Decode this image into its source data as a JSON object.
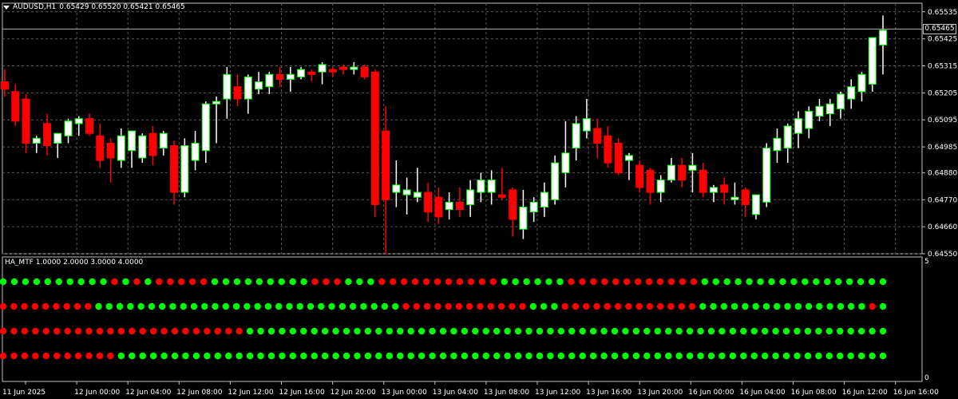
{
  "header": {
    "symbol": "AUDUSD,H1",
    "ohlc": "0.65429 0.65520 0.65421 0.65465"
  },
  "indicator": {
    "label": "HA_MTF 1.0000 2.0000 3.0000 4.0000",
    "scale_top": "5",
    "scale_bottom": "0"
  },
  "current_price": "0.65465",
  "colors": {
    "bull": "#00ff00",
    "bear": "#ff0000",
    "bull_body": "#ffffff",
    "bear_body": "#ff0000",
    "grid": "#5a5a5a",
    "background": "#000000"
  },
  "chart_data": {
    "type": "candlestick",
    "ylim": [
      0.6455,
      0.6557
    ],
    "price_ticks": [
      "0.65535",
      "0.65425",
      "0.65315",
      "0.65205",
      "0.65095",
      "0.64985",
      "0.64880",
      "0.64770",
      "0.64660",
      "0.64550"
    ],
    "time_labels": [
      "11 Jun 2025",
      "12 Jun 00:00",
      "12 Jun 04:00",
      "12 Jun 08:00",
      "12 Jun 12:00",
      "12 Jun 16:00",
      "12 Jun 20:00",
      "13 Jun 00:00",
      "13 Jun 04:00",
      "13 Jun 08:00",
      "13 Jun 12:00",
      "13 Jun 16:00",
      "13 Jun 20:00",
      "16 Jun 00:00",
      "16 Jun 04:00",
      "16 Jun 08:00",
      "16 Jun 12:00",
      "16 Jun 16:00"
    ],
    "candles": [
      [
        0.6525,
        0.653,
        0.6519,
        0.6522
      ],
      [
        0.6521,
        0.6524,
        0.6507,
        0.6509
      ],
      [
        0.6518,
        0.652,
        0.6496,
        0.65
      ],
      [
        0.65,
        0.6503,
        0.6496,
        0.6502
      ],
      [
        0.6508,
        0.6512,
        0.6495,
        0.6499
      ],
      [
        0.65,
        0.6504,
        0.6494,
        0.6504
      ],
      [
        0.6503,
        0.651,
        0.65,
        0.6509
      ],
      [
        0.6508,
        0.6511,
        0.6503,
        0.651
      ],
      [
        0.651,
        0.6512,
        0.6503,
        0.6504
      ],
      [
        0.6503,
        0.6508,
        0.649,
        0.6493
      ],
      [
        0.65,
        0.6502,
        0.6484,
        0.6494
      ],
      [
        0.6493,
        0.6506,
        0.649,
        0.6503
      ],
      [
        0.6497,
        0.6504,
        0.649,
        0.6505
      ],
      [
        0.6494,
        0.6504,
        0.6492,
        0.6503
      ],
      [
        0.6504,
        0.6507,
        0.6491,
        0.6495
      ],
      [
        0.6498,
        0.6505,
        0.6495,
        0.6504
      ],
      [
        0.6499,
        0.6501,
        0.6475,
        0.648
      ],
      [
        0.648,
        0.6502,
        0.6478,
        0.6499
      ],
      [
        0.6493,
        0.6505,
        0.6489,
        0.65
      ],
      [
        0.6497,
        0.6517,
        0.6492,
        0.6516
      ],
      [
        0.6516,
        0.6519,
        0.65,
        0.6517
      ],
      [
        0.6518,
        0.6531,
        0.651,
        0.6528
      ],
      [
        0.6523,
        0.6528,
        0.6515,
        0.6518
      ],
      [
        0.6518,
        0.6528,
        0.6512,
        0.6527
      ],
      [
        0.6522,
        0.6529,
        0.652,
        0.6525
      ],
      [
        0.6523,
        0.6529,
        0.652,
        0.6528
      ],
      [
        0.6528,
        0.6531,
        0.6523,
        0.6526
      ],
      [
        0.6526,
        0.6531,
        0.6521,
        0.6528
      ],
      [
        0.6527,
        0.6531,
        0.6526,
        0.653
      ],
      [
        0.6529,
        0.653,
        0.6525,
        0.6528
      ],
      [
        0.6529,
        0.6533,
        0.6524,
        0.6532
      ],
      [
        0.653,
        0.6531,
        0.6527,
        0.6529
      ],
      [
        0.6531,
        0.6532,
        0.6528,
        0.653
      ],
      [
        0.653,
        0.6533,
        0.6528,
        0.6531
      ],
      [
        0.6531,
        0.6532,
        0.6526,
        0.6527
      ],
      [
        0.6529,
        0.653,
        0.647,
        0.6475
      ],
      [
        0.6505,
        0.6515,
        0.6455,
        0.6477
      ],
      [
        0.648,
        0.6493,
        0.6474,
        0.6483
      ],
      [
        0.6479,
        0.6486,
        0.6471,
        0.6481
      ],
      [
        0.6478,
        0.649,
        0.6476,
        0.648
      ],
      [
        0.648,
        0.6484,
        0.6468,
        0.6472
      ],
      [
        0.6478,
        0.6482,
        0.6467,
        0.647
      ],
      [
        0.6473,
        0.648,
        0.6469,
        0.6476
      ],
      [
        0.6476,
        0.6482,
        0.647,
        0.6473
      ],
      [
        0.6475,
        0.6485,
        0.647,
        0.6481
      ],
      [
        0.648,
        0.6488,
        0.6476,
        0.6485
      ],
      [
        0.648,
        0.6489,
        0.6475,
        0.6485
      ],
      [
        0.6479,
        0.649,
        0.6477,
        0.6478
      ],
      [
        0.6481,
        0.6482,
        0.6462,
        0.6469
      ],
      [
        0.6465,
        0.6481,
        0.6461,
        0.6474
      ],
      [
        0.6472,
        0.6478,
        0.6468,
        0.6476
      ],
      [
        0.6474,
        0.6484,
        0.647,
        0.648
      ],
      [
        0.6477,
        0.6495,
        0.6475,
        0.6492
      ],
      [
        0.6488,
        0.6509,
        0.6482,
        0.6496
      ],
      [
        0.6498,
        0.6511,
        0.6493,
        0.6508
      ],
      [
        0.6505,
        0.6518,
        0.6502,
        0.651
      ],
      [
        0.6506,
        0.651,
        0.6494,
        0.65
      ],
      [
        0.6503,
        0.6507,
        0.649,
        0.6492
      ],
      [
        0.65,
        0.6502,
        0.6487,
        0.6488
      ],
      [
        0.6493,
        0.6496,
        0.6485,
        0.6495
      ],
      [
        0.6491,
        0.6493,
        0.648,
        0.6482
      ],
      [
        0.6489,
        0.649,
        0.6475,
        0.648
      ],
      [
        0.648,
        0.6487,
        0.6476,
        0.6485
      ],
      [
        0.6485,
        0.6494,
        0.6484,
        0.6491
      ],
      [
        0.6491,
        0.6494,
        0.6482,
        0.6485
      ],
      [
        0.6489,
        0.6496,
        0.648,
        0.6491
      ],
      [
        0.6489,
        0.6492,
        0.6478,
        0.648
      ],
      [
        0.648,
        0.6483,
        0.6476,
        0.6482
      ],
      [
        0.6483,
        0.6486,
        0.6475,
        0.648
      ],
      [
        0.6477,
        0.6484,
        0.6475,
        0.6478
      ],
      [
        0.6481,
        0.6482,
        0.647,
        0.6475
      ],
      [
        0.6471,
        0.6478,
        0.6469,
        0.6479
      ],
      [
        0.6476,
        0.65,
        0.6474,
        0.6498
      ],
      [
        0.6497,
        0.6506,
        0.6492,
        0.6502
      ],
      [
        0.6498,
        0.6508,
        0.6492,
        0.6507
      ],
      [
        0.6504,
        0.6513,
        0.6498,
        0.651
      ],
      [
        0.6506,
        0.6515,
        0.6502,
        0.6513
      ],
      [
        0.6511,
        0.6518,
        0.6509,
        0.6515
      ],
      [
        0.6512,
        0.6518,
        0.6507,
        0.6516
      ],
      [
        0.6514,
        0.6521,
        0.651,
        0.652
      ],
      [
        0.6518,
        0.6526,
        0.6514,
        0.6523
      ],
      [
        0.6521,
        0.6529,
        0.6517,
        0.6528
      ],
      [
        0.6524,
        0.6543,
        0.6521,
        0.6543
      ],
      [
        0.654,
        0.6552,
        0.6528,
        0.6546
      ]
    ],
    "mtf_rows": [
      "ggggggggggrgrgrrrrrgggggggggrrrgggrrrrrrrrrrrggggggrrrrrrrrrrrrggggggggggggggggg",
      "rrrrrrrrrgggggggggggggggggggggggggggggrrrrrrrrrrrrgggrrrrrrrrrrrrrggggggggggggggggrg",
      "rrrrrrrrrrrrrrrrrrrrrrrgggggggggggggggggggggggggggggggggggggggggggggggggggggggggggg",
      "rrrrrrrrrrrgggggggggggggggggggggggggggggggggggggggggggggggggggggggggggggggggggggggg"
    ]
  }
}
